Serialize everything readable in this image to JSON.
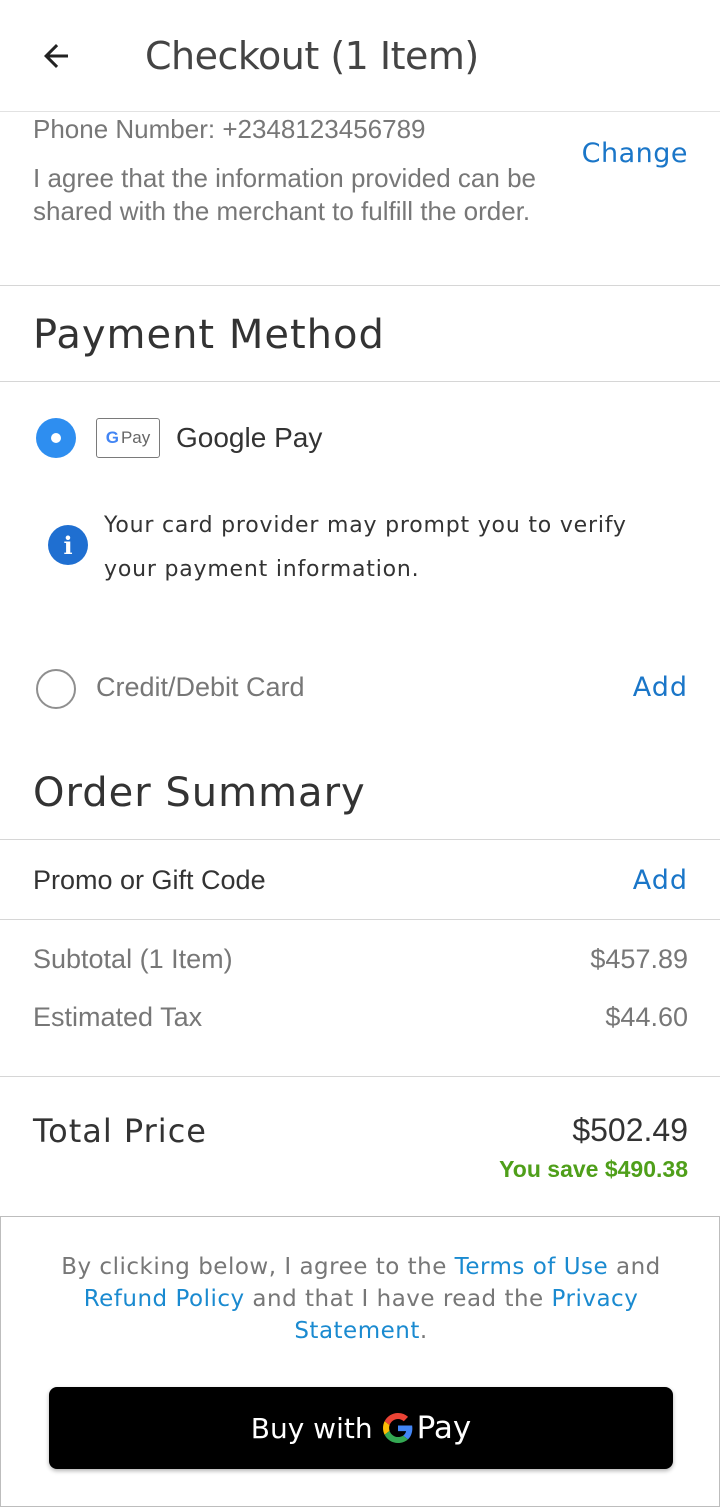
{
  "header": {
    "title": "Checkout (1 Item)"
  },
  "contact": {
    "phone": "Phone Number: +2348123456789",
    "agreement": "I agree that the information provided can be shared with the merchant to fulfill the order.",
    "change_label": "Change"
  },
  "payment": {
    "title": "Payment Method",
    "options": [
      {
        "label": "Google Pay",
        "selected": true,
        "badge": {
          "g": "G",
          "text": "Pay"
        }
      },
      {
        "label": "Credit/Debit Card",
        "selected": false,
        "action_label": "Add"
      }
    ],
    "info_notice": "Your card provider may prompt you to verify your payment information."
  },
  "order": {
    "title": "Order Summary",
    "promo_label": "Promo or Gift Code",
    "promo_action": "Add",
    "lines": [
      {
        "label": "Subtotal (1 Item)",
        "value": "$457.89"
      },
      {
        "label": "Estimated Tax",
        "value": "$44.60"
      }
    ],
    "total_label": "Total Price",
    "total_value": "$502.49",
    "savings": "You save $490.38"
  },
  "footer": {
    "legal_part1": "By clicking below, I agree to the ",
    "terms_link": "Terms of Use",
    "legal_part2": " and ",
    "refund_link": "Refund Policy",
    "legal_part3": " and that I have read the ",
    "privacy_link": "Privacy Statement",
    "legal_part4": ".",
    "buy_label": "Buy with",
    "buy_brand": "Pay"
  },
  "colors": {
    "accent": "#1a76c8",
    "radio_selected": "#2e8ef0",
    "savings": "#4f9f1a",
    "button_bg": "#000000"
  },
  "icons": {
    "back": "arrow-left-icon",
    "info": "info-circle-icon",
    "google": "google-g-icon"
  }
}
